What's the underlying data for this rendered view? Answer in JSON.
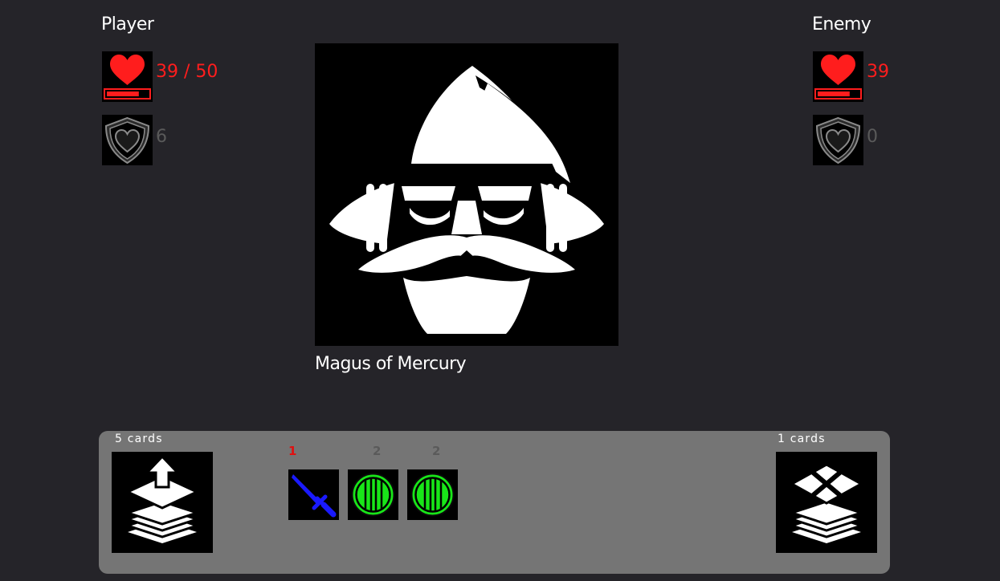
{
  "player": {
    "title": "Player",
    "hp_text": "39 / 50",
    "hp_fraction": 0.78,
    "block": "6",
    "heart_icon": "heart-icon",
    "shield_icon": "shield-heart-icon"
  },
  "enemy": {
    "title": "Enemy",
    "name": "Magus of Mercury",
    "hp_text": "39",
    "hp_fraction": 0.78,
    "block": "0",
    "portrait_icon": "wizard-icon"
  },
  "hand": {
    "draw_pile_count": "5 cards",
    "discard_pile_count": "1 cards",
    "draw_pile_icon": "draw-pile-icon",
    "discard_pile_icon": "discard-pile-icon",
    "cards": [
      {
        "cost": "1",
        "icon": "dagger-icon",
        "cost_color": "#e01010"
      },
      {
        "cost": "2",
        "icon": "round-shield-icon",
        "cost_color": "#5a5a5a"
      },
      {
        "cost": "2",
        "icon": "round-shield-icon",
        "cost_color": "#5a5a5a"
      }
    ]
  },
  "colors": {
    "background": "#252429",
    "panel": "#757575",
    "hp": "#ff1d1d",
    "muted": "#5a5a5a",
    "dagger": "#1a1aff",
    "shield": "#19e619"
  }
}
